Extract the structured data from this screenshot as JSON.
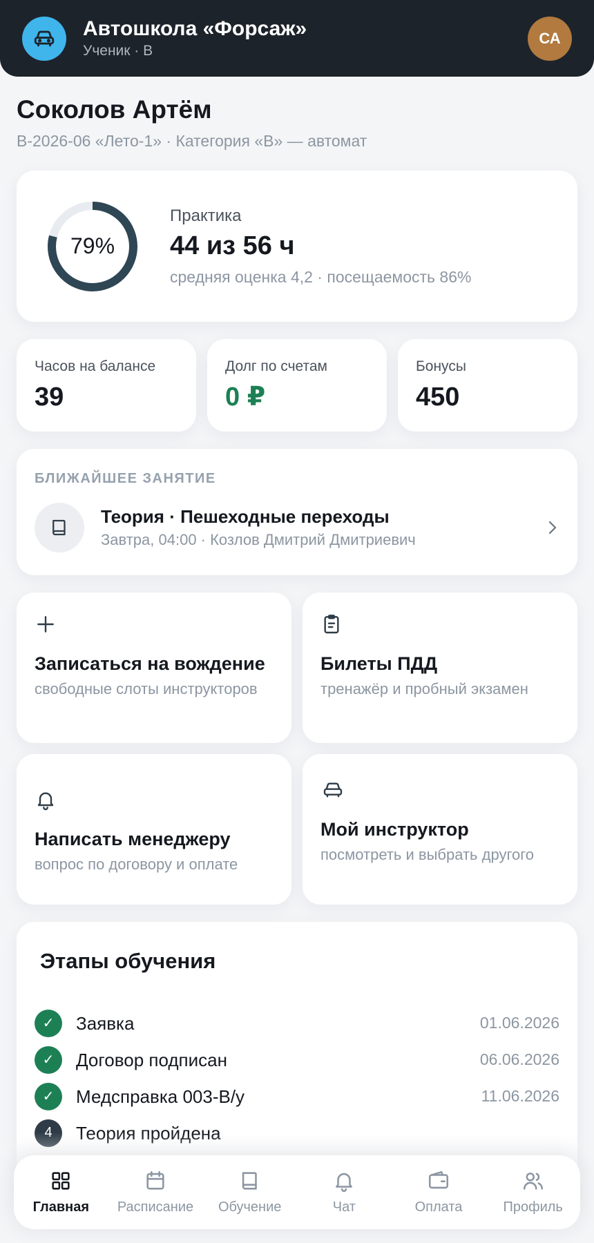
{
  "header": {
    "title": "Автошкола «Форсаж»",
    "subtitle": "Ученик · B",
    "avatar_initials": "СА",
    "logo_icon": "car-icon"
  },
  "student": {
    "name": "Соколов Артём",
    "group": "B-2026-06 «Лето-1» · Категория «B» — автомат"
  },
  "practice": {
    "progress_percent": 79,
    "progress_label": "79%",
    "title": "Практика",
    "value": "44 из 56 ч",
    "meta": "средняя оценка 4,2 · посещаемость 86%"
  },
  "stats": [
    {
      "label": "Часов на балансе",
      "value": "39"
    },
    {
      "label": "Долг по счетам",
      "value": "0 ₽",
      "color": "#1d8055"
    },
    {
      "label": "Бонусы",
      "value": "450"
    }
  ],
  "next_lesson": {
    "caption": "БЛИЖАЙШЕЕ ЗАНЯТИЕ",
    "title": "Теория · Пешеходные переходы",
    "subtitle": "Завтра, 04:00 · Козлов Дмитрий Дмитриевич",
    "icon": "book-icon"
  },
  "tiles": [
    {
      "title": "Записаться на вождение",
      "subtitle": "свободные слоты инструкторов",
      "icon": "plus-icon"
    },
    {
      "title": "Билеты ПДД",
      "subtitle": "тренажёр и пробный экзамен",
      "icon": "clipboard-icon"
    },
    {
      "title": "Написать менеджеру",
      "subtitle": "вопрос по договору и оплате",
      "icon": "bell-icon"
    },
    {
      "title": "Мой инструктор",
      "subtitle": "посмотреть и выбрать другого",
      "icon": "car-icon"
    }
  ],
  "stages": {
    "title": "Этапы обучения",
    "items": [
      {
        "mark": "✓",
        "name": "Заявка",
        "date": "01.06.2026",
        "status": "done"
      },
      {
        "mark": "✓",
        "name": "Договор подписан",
        "date": "06.06.2026",
        "status": "done"
      },
      {
        "mark": "✓",
        "name": "Медсправка 003-В/у",
        "date": "11.06.2026",
        "status": "done"
      },
      {
        "mark": "4",
        "name": "Теория пройдена",
        "date": "",
        "status": "current"
      }
    ]
  },
  "nav": [
    {
      "label": "Главная",
      "icon": "grid-icon",
      "active": true
    },
    {
      "label": "Расписание",
      "icon": "calendar-icon",
      "active": false
    },
    {
      "label": "Обучение",
      "icon": "book-icon",
      "active": false
    },
    {
      "label": "Чат",
      "icon": "bell-icon",
      "active": false
    },
    {
      "label": "Оплата",
      "icon": "wallet-icon",
      "active": false
    },
    {
      "label": "Профиль",
      "icon": "users-icon",
      "active": false
    }
  ],
  "colors": {
    "header_bg": "#1d232b",
    "logo_bg": "#3fb5ec",
    "avatar_bg": "#b27a3f",
    "done": "#1d8055",
    "ring": "#2f4654"
  }
}
